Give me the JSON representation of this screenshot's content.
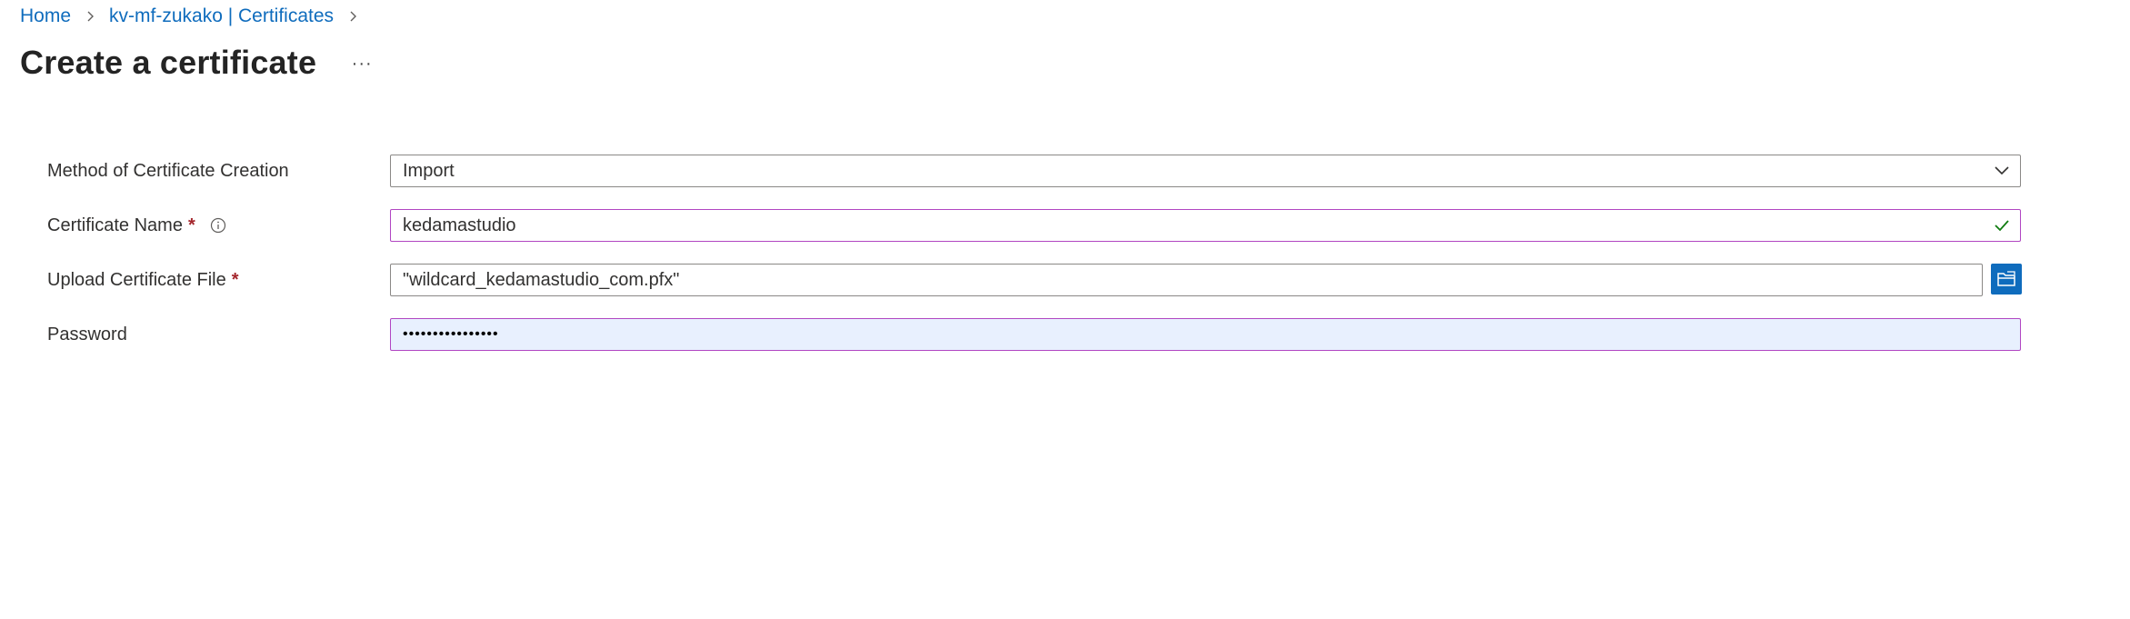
{
  "breadcrumb": {
    "items": [
      {
        "label": "Home"
      },
      {
        "label": "kv-mf-zukako | Certificates"
      }
    ]
  },
  "header": {
    "title": "Create a certificate",
    "more_label": "···"
  },
  "form": {
    "method": {
      "label": "Method of Certificate Creation",
      "value": "Import"
    },
    "certificate_name": {
      "label": "Certificate Name",
      "required_mark": "*",
      "value": "kedamastudio"
    },
    "upload_file": {
      "label": "Upload Certificate File",
      "required_mark": "*",
      "value": "\"wildcard_kedamastudio_com.pfx\""
    },
    "password": {
      "label": "Password",
      "value": "••••••••••••••••"
    }
  },
  "colors": {
    "link": "#0f6cbd",
    "required": "#a4262c",
    "focus_border": "#b146c2",
    "autofill_bg": "#e8f0fe",
    "valid_check": "#107c10",
    "browse_button": "#0f6cbd"
  },
  "icons": {
    "breadcrumb_separator": "chevron-right-icon",
    "info": "info-icon",
    "dropdown": "chevron-down-icon",
    "valid": "checkmark-icon",
    "browse": "folder-open-icon"
  }
}
